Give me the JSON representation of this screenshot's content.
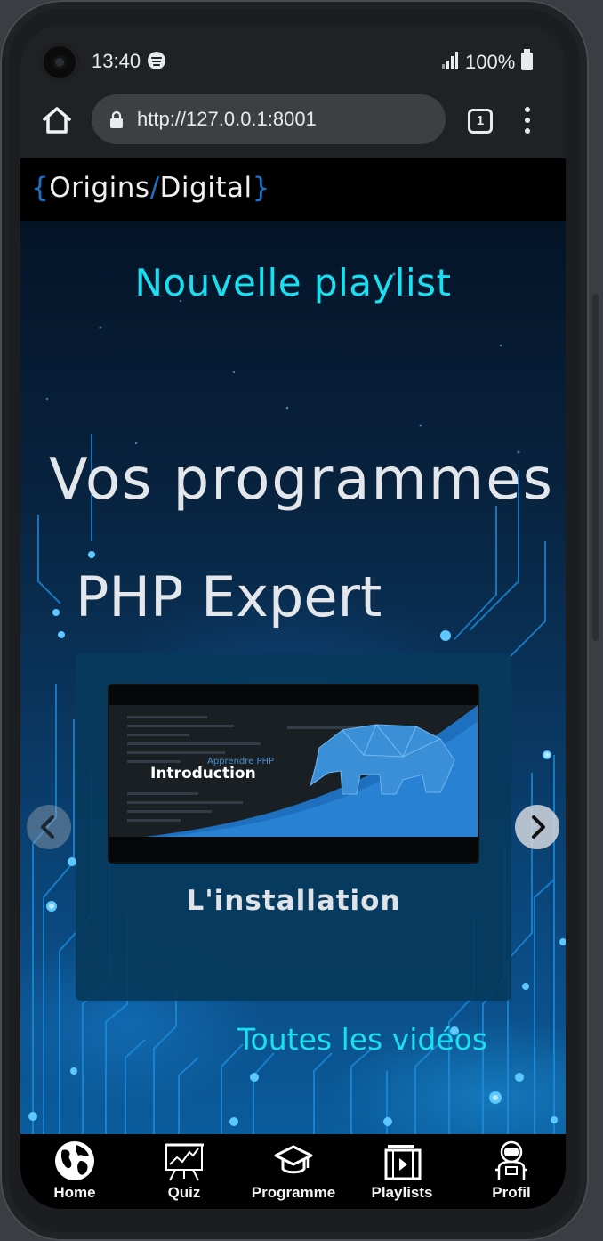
{
  "status_bar": {
    "time": "13:40",
    "battery": "100%",
    "icons": [
      "camera-cutout",
      "spotify-icon",
      "signal-icon",
      "battery-icon"
    ]
  },
  "browser": {
    "url": "http://127.0.0.1:8001",
    "tab_count": "1",
    "icons": [
      "home-icon",
      "lock-icon",
      "tabs-icon",
      "menu-icon"
    ]
  },
  "site": {
    "logo": {
      "brace_open": "{",
      "part1": "Origins",
      "slash": "/",
      "part2": "Digital",
      "brace_close": "}"
    },
    "new_playlist_link": "Nouvelle playlist",
    "section_title": "Vos programmes",
    "playlist_title": "PHP Expert",
    "carousel": {
      "video_title": "L'installation",
      "thumbnail": {
        "small_title": "Apprendre PHP",
        "big_title": "Introduction"
      },
      "prev_icon": "chevron-left-icon",
      "next_icon": "chevron-right-icon"
    },
    "all_videos_link": "Toutes les vidéos"
  },
  "bottom_nav": {
    "items": [
      {
        "label": "Home",
        "icon": "globe-icon"
      },
      {
        "label": "Quiz",
        "icon": "presentation-chart-icon"
      },
      {
        "label": "Programme",
        "icon": "graduation-cap-icon"
      },
      {
        "label": "Playlists",
        "icon": "video-playlist-icon"
      },
      {
        "label": "Profil",
        "icon": "astronaut-icon"
      }
    ]
  },
  "colors": {
    "accent_cyan": "#19e0f0",
    "logo_blue": "#1c74c9",
    "card_bg": "#063a5c",
    "nav_bg": "#000000"
  }
}
